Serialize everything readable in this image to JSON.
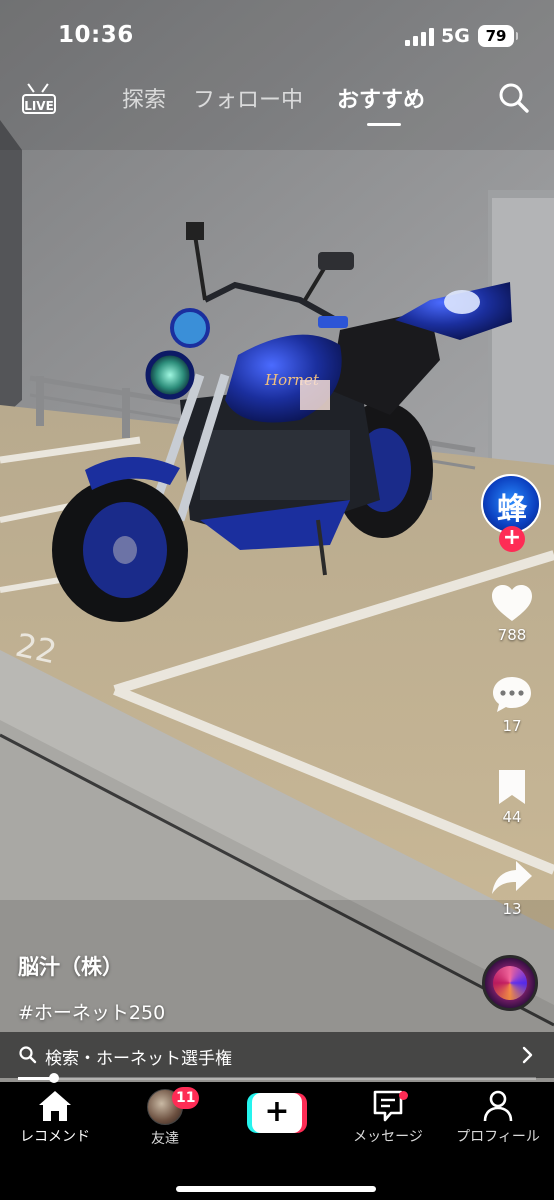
{
  "status_bar": {
    "time": "10:36",
    "network": "5G",
    "battery": "79"
  },
  "top_nav": {
    "live_label": "LIVE",
    "tabs": [
      {
        "label": "探索",
        "active": false
      },
      {
        "label": "フォロー中",
        "active": false
      },
      {
        "label": "おすすめ",
        "active": true
      }
    ]
  },
  "video": {
    "creator_avatar_text": "蜂",
    "like_count": "788",
    "comment_count": "17",
    "save_count": "44",
    "share_count": "13",
    "parking_number": "22",
    "author": "脳汁（株）",
    "hashtag": "#ホーネット250",
    "sticker_label": "Hornet"
  },
  "related_search": {
    "text": "検索・ホーネット選手権"
  },
  "progress": {
    "fraction": 0.07
  },
  "bottom_nav": {
    "items": [
      {
        "label": "レコメンド",
        "active": true
      },
      {
        "label": "友達",
        "badge": "11"
      },
      {
        "label": ""
      },
      {
        "label": "メッセージ",
        "dot": true
      },
      {
        "label": "プロフィール"
      }
    ]
  },
  "colors": {
    "accent": "#fe2c55",
    "cyan": "#25f4ee",
    "bike_blue": "#1b2f9e"
  },
  "icons": [
    "live-icon",
    "search-icon",
    "heart-icon",
    "comment-icon",
    "bookmark-icon",
    "share-icon",
    "home-icon",
    "plus-icon",
    "message-icon",
    "profile-icon",
    "chevron-right-icon"
  ]
}
